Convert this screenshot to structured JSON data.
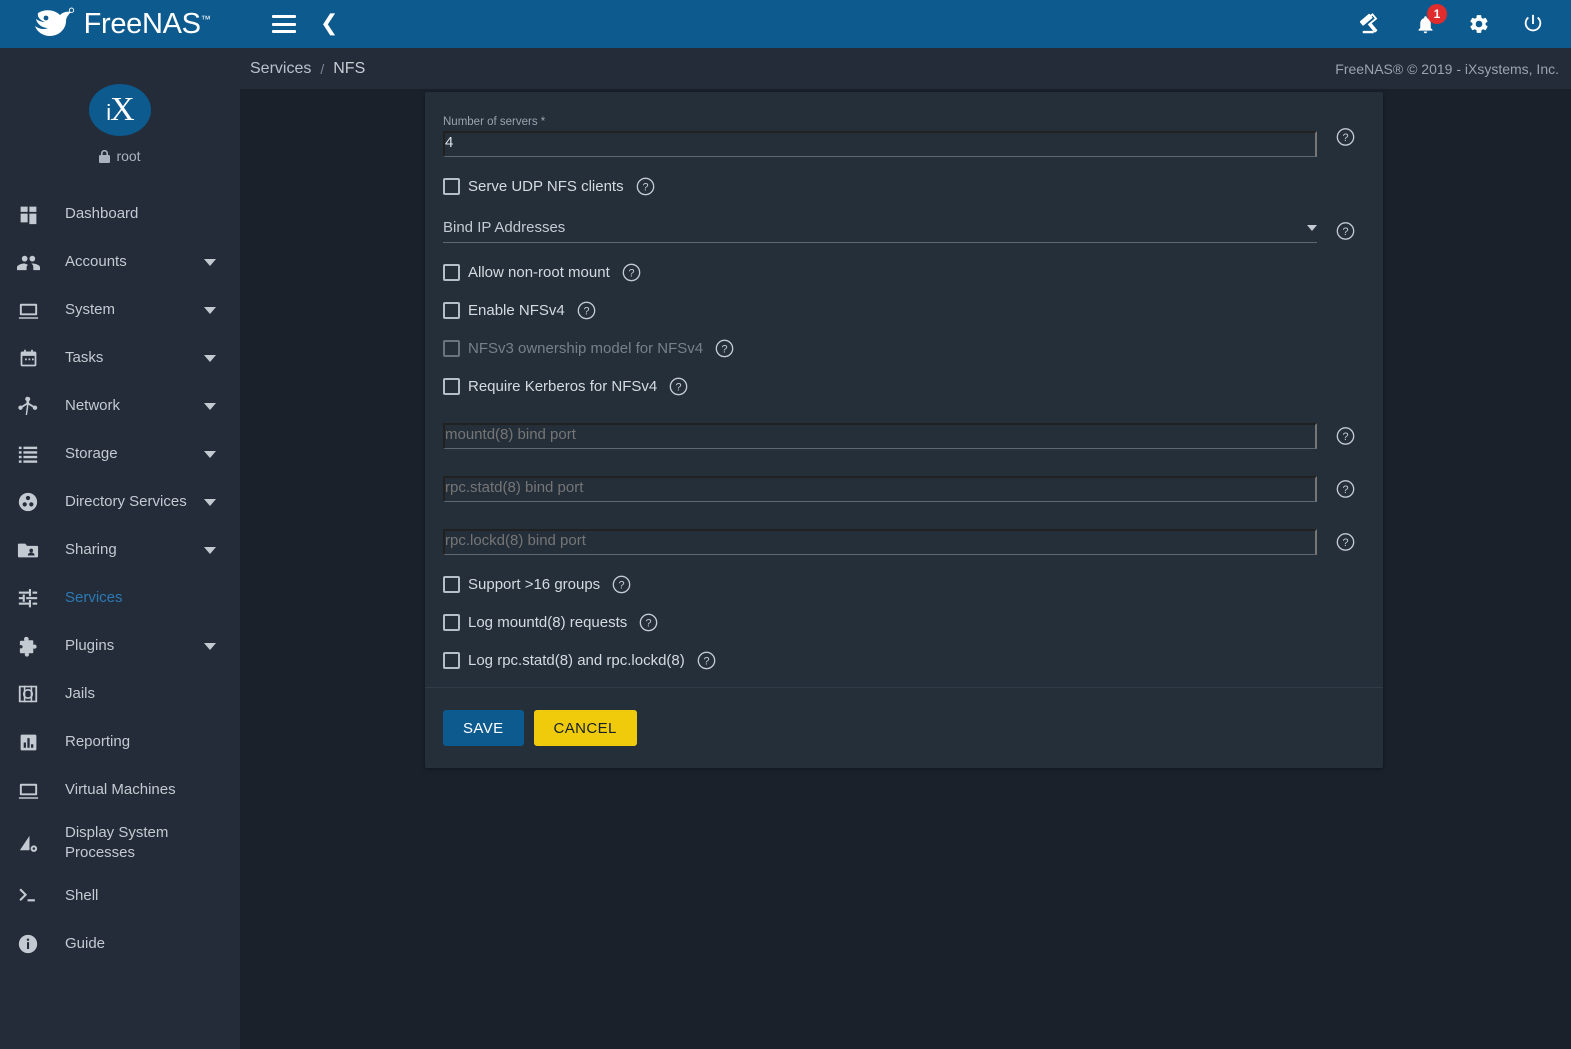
{
  "brand": {
    "name": "FreeNAS",
    "trademark": "™",
    "logo_icon": "freenas-fish-logo",
    "accent_blue": "#0d5a8f",
    "panel_bg": "#252f3a",
    "page_bg": "#1a212b",
    "sidebar_bg": "#232c38",
    "active_link": "#2b7ab5",
    "cancel_yellow": "#f0cb0b",
    "badge_red": "#e02c2c"
  },
  "topbar": {
    "menu_icon": "hamburger-menu-icon",
    "collapse_icon": "chevron-left-icon",
    "theme_icon": "format-paint-icon",
    "alerts_icon": "bell-icon",
    "alerts_count": "1",
    "settings_icon": "gear-icon",
    "power_icon": "power-icon"
  },
  "breadcrumb": {
    "parent": "Services",
    "separator": "/",
    "current": "NFS",
    "copyright": "FreeNAS® © 2019 - iXsystems, Inc."
  },
  "sidebar": {
    "avatar_text": "iX",
    "avatar_i": "i",
    "avatar_x": "X",
    "lock_icon": "lock-icon",
    "username": "root",
    "items": [
      {
        "label": "Dashboard",
        "icon": "dashboard-icon",
        "expandable": false,
        "active": false
      },
      {
        "label": "Accounts",
        "icon": "people-icon",
        "expandable": true,
        "active": false
      },
      {
        "label": "System",
        "icon": "monitor-icon",
        "expandable": true,
        "active": false
      },
      {
        "label": "Tasks",
        "icon": "calendar-icon",
        "expandable": true,
        "active": false
      },
      {
        "label": "Network",
        "icon": "network-node-icon",
        "expandable": true,
        "active": false
      },
      {
        "label": "Storage",
        "icon": "storage-list-icon",
        "expandable": true,
        "active": false
      },
      {
        "label": "Directory Services",
        "icon": "directory-services-icon",
        "expandable": true,
        "active": false
      },
      {
        "label": "Sharing",
        "icon": "folder-share-icon",
        "expandable": true,
        "active": false
      },
      {
        "label": "Services",
        "icon": "sliders-icon",
        "expandable": false,
        "active": true
      },
      {
        "label": "Plugins",
        "icon": "puzzle-icon",
        "expandable": true,
        "active": false
      },
      {
        "label": "Jails",
        "icon": "jail-icon",
        "expandable": false,
        "active": false
      },
      {
        "label": "Reporting",
        "icon": "bar-chart-icon",
        "expandable": false,
        "active": false
      },
      {
        "label": "Virtual Machines",
        "icon": "monitor-icon",
        "expandable": false,
        "active": false
      },
      {
        "label": "Display System Processes",
        "icon": "processes-icon",
        "expandable": false,
        "active": false
      },
      {
        "label": "Shell",
        "icon": "terminal-icon",
        "expandable": false,
        "active": false
      },
      {
        "label": "Guide",
        "icon": "info-circle-icon",
        "expandable": false,
        "active": false
      }
    ]
  },
  "form": {
    "help_icon": "question-mark-circle-icon",
    "number_of_servers": {
      "label": "Number of servers *",
      "value": "4",
      "help": "question-mark-circle-icon"
    },
    "serve_udp": {
      "label": "Serve UDP NFS clients",
      "checked": false,
      "disabled": false
    },
    "bind_ip": {
      "label": "Bind IP Addresses",
      "value": "",
      "caret_icon": "chevron-down-icon"
    },
    "allow_nonroot": {
      "label": "Allow non-root mount",
      "checked": false,
      "disabled": false
    },
    "enable_nfsv4": {
      "label": "Enable NFSv4",
      "checked": false,
      "disabled": false
    },
    "nfsv3_ownership": {
      "label": "NFSv3 ownership model for NFSv4",
      "checked": false,
      "disabled": true
    },
    "require_kerberos": {
      "label": "Require Kerberos for NFSv4",
      "checked": false,
      "disabled": false
    },
    "mountd_port": {
      "placeholder": "mountd(8) bind port",
      "value": ""
    },
    "statd_port": {
      "placeholder": "rpc.statd(8) bind port",
      "value": ""
    },
    "lockd_port": {
      "placeholder": "rpc.lockd(8) bind port",
      "value": ""
    },
    "support_16_groups": {
      "label": "Support >16 groups",
      "checked": false,
      "disabled": false
    },
    "log_mountd": {
      "label": "Log mountd(8) requests",
      "checked": false,
      "disabled": false
    },
    "log_statd_lockd": {
      "label": "Log rpc.statd(8) and rpc.lockd(8)",
      "checked": false,
      "disabled": false
    },
    "save_label": "SAVE",
    "cancel_label": "CANCEL"
  }
}
